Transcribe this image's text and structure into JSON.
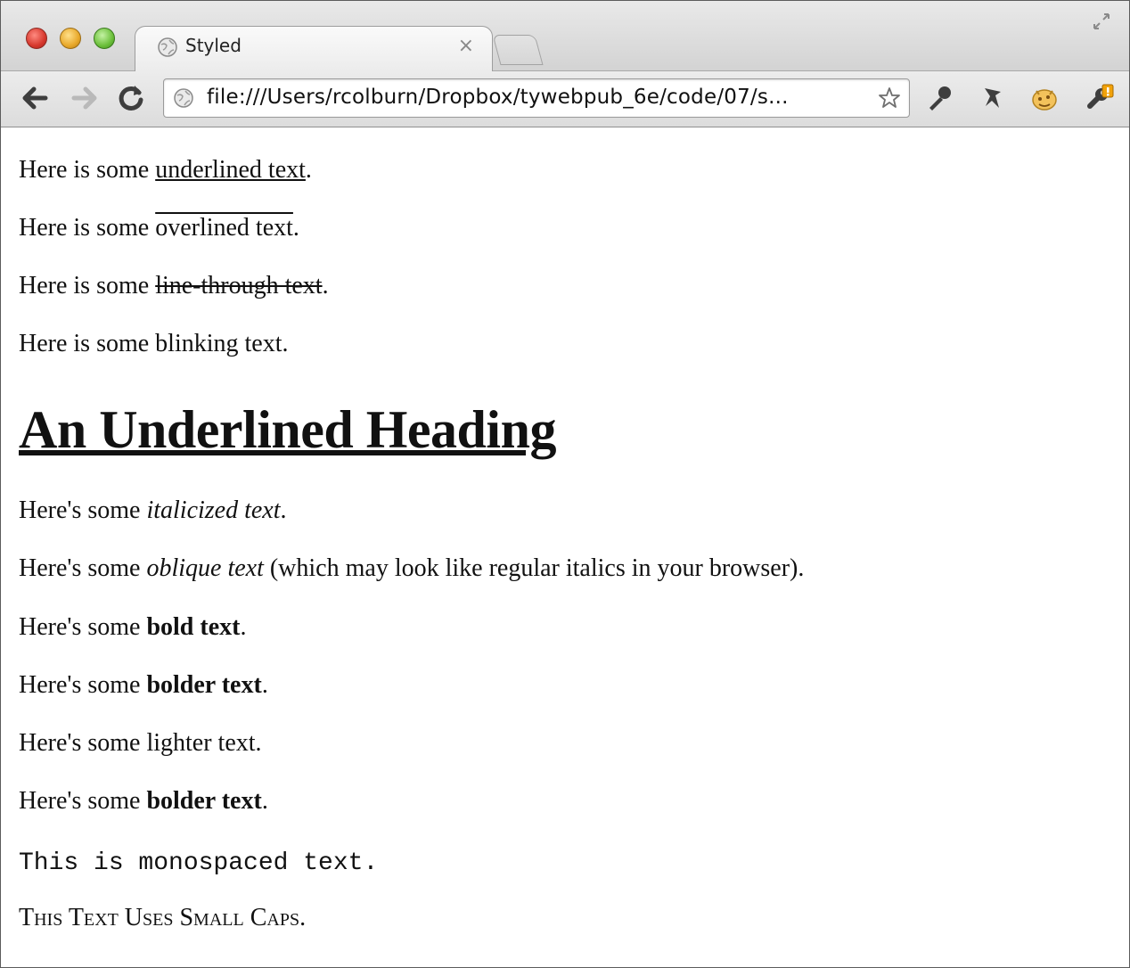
{
  "tab": {
    "title": "Styled",
    "close_glyph": "×"
  },
  "toolbar": {
    "url": "file:///Users/rcolburn/Dropbox/tywebpub_6e/code/07/s..."
  },
  "icons": {
    "back": "back-arrow-icon",
    "forward": "forward-arrow-icon",
    "reload": "reload-icon",
    "page": "globe-icon",
    "bookmark": "star-icon",
    "ext1": "wrench-key-icon",
    "ext2": "pin-icon",
    "ext3": "cookie-extension-icon",
    "menu": "wrench-menu-icon"
  },
  "content": {
    "p1": {
      "pre": "Here is some ",
      "styled": "underlined text",
      "post": "."
    },
    "p2": {
      "pre": "Here is some ",
      "styled": "overlined text",
      "post": "."
    },
    "p3": {
      "pre": "Here is some ",
      "styled": "line-through text",
      "post": "."
    },
    "p4": {
      "text": "Here is some blinking text."
    },
    "heading": "An Underlined Heading",
    "p5": {
      "pre": "Here's some ",
      "styled": "italicized text",
      "post": "."
    },
    "p6": {
      "pre": "Here's some ",
      "styled": "oblique text",
      "post": " (which may look like regular italics in your browser)."
    },
    "p7": {
      "pre": "Here's some ",
      "styled": "bold text",
      "post": "."
    },
    "p8": {
      "pre": "Here's some ",
      "styled": "bolder text",
      "post": "."
    },
    "p9": {
      "text": "Here's some lighter text."
    },
    "p10": {
      "pre": "Here's some ",
      "styled": "bolder text",
      "post": "."
    },
    "p11": {
      "text": "This is monospaced text."
    },
    "p12": {
      "text": "This Text Uses Small Caps."
    }
  }
}
